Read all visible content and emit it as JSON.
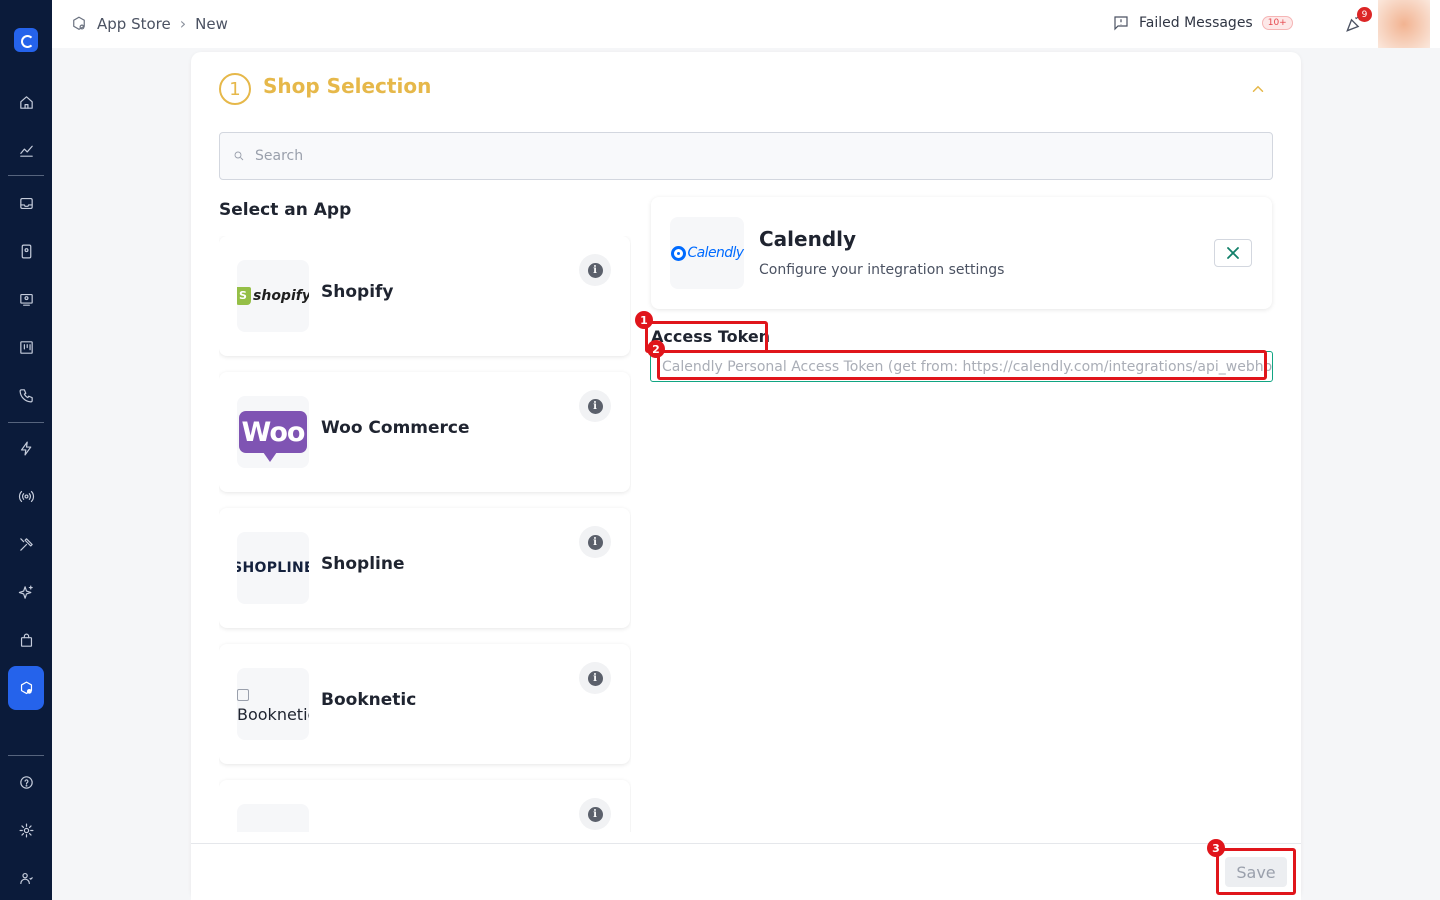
{
  "topbar": {
    "breadcrumb": [
      "App Store",
      "New"
    ],
    "failed_messages_label": "Failed Messages",
    "failed_messages_count": "10+",
    "notification_count": "9"
  },
  "sidebar": {
    "icons": [
      "home-icon",
      "analytics-icon",
      "inbox-icon",
      "contacts-icon",
      "broadcast-icon",
      "board-icon",
      "phone-icon",
      "automation-icon",
      "signal-icon",
      "tools-icon",
      "ai-sparkle-icon",
      "store-bag-icon",
      "app-store-icon",
      "help-icon",
      "settings-icon",
      "users-icon"
    ],
    "active_item": "app-store-icon"
  },
  "section": {
    "step_number": "1",
    "title": "Shop Selection",
    "search_placeholder": "Search",
    "select_heading": "Select an App"
  },
  "apps": [
    {
      "name": "Shopify",
      "logo_text": "shopify"
    },
    {
      "name": "Woo Commerce",
      "logo_text": "Woo"
    },
    {
      "name": "Shopline",
      "logo_text": "SHOPLINE"
    },
    {
      "name": "Booknetic",
      "logo_text": "Booknetic"
    }
  ],
  "config": {
    "app_name": "Calendly",
    "subtitle": "Configure your integration settings",
    "logo_text": "Calendly",
    "field_label": "Access Token",
    "field_placeholder": "Calendly Personal Access Token (get from: https://calendly.com/integrations/api_webhooks)",
    "field_value": ""
  },
  "footer": {
    "save_label": "Save"
  },
  "annotations": [
    "1",
    "2",
    "3"
  ],
  "colors": {
    "sidebar_bg": "#0b1b3a",
    "accent_blue": "#2563eb",
    "step_color": "#e6b84a",
    "input_focus": "#12a583",
    "annotation_red": "#e0151b"
  }
}
